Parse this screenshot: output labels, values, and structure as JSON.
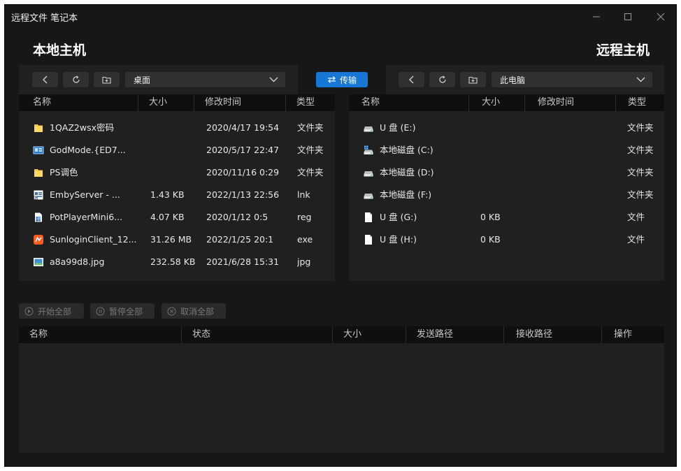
{
  "window": {
    "title": "远程文件 笔记本"
  },
  "local": {
    "heading": "本地主机",
    "path": "桌面",
    "columns": [
      "名称",
      "大小",
      "修改时间",
      "类型"
    ],
    "files": [
      {
        "name": "1QAZ2wsx密码",
        "size": "",
        "modified": "2020/4/17 19:54",
        "type": "文件夹",
        "icon": "folder-icon"
      },
      {
        "name": "GodMode.{ED7...",
        "size": "",
        "modified": "2020/5/17 22:47",
        "type": "文件夹",
        "icon": "control-panel-icon"
      },
      {
        "name": "PS调色",
        "size": "",
        "modified": "2020/11/16 0:29",
        "type": "文件夹",
        "icon": "folder-icon"
      },
      {
        "name": "EmbyServer - ...",
        "size": "1.43 KB",
        "modified": "2022/1/13 22:56",
        "type": "lnk",
        "icon": "shortcut-icon"
      },
      {
        "name": "PotPlayerMini6...",
        "size": "4.07 KB",
        "modified": "2020/1/12 0:5",
        "type": "reg",
        "icon": "registry-icon"
      },
      {
        "name": "SunloginClient_12...",
        "size": "31.26 MB",
        "modified": "2022/1/25 20:1",
        "type": "exe",
        "icon": "sunlogin-app-icon"
      },
      {
        "name": "a8a99d8.jpg",
        "size": "232.58 KB",
        "modified": "2021/6/28 15:31",
        "type": "jpg",
        "icon": "image-file-icon"
      }
    ]
  },
  "transfer": {
    "label": "传输"
  },
  "remote": {
    "heading": "远程主机",
    "path": "此电脑",
    "columns": [
      "名称",
      "大小",
      "修改时间",
      "类型"
    ],
    "files": [
      {
        "name": "U 盘 (E:)",
        "size": "",
        "modified": "",
        "type": "文件夹",
        "icon": "drive-icon"
      },
      {
        "name": "本地磁盘 (C:)",
        "size": "",
        "modified": "",
        "type": "文件夹",
        "icon": "system-drive-icon"
      },
      {
        "name": "本地磁盘 (D:)",
        "size": "",
        "modified": "",
        "type": "文件夹",
        "icon": "drive-icon"
      },
      {
        "name": "本地磁盘 (F:)",
        "size": "",
        "modified": "",
        "type": "文件夹",
        "icon": "drive-icon"
      },
      {
        "name": "U 盘 (G:)",
        "size": "0 KB",
        "modified": "",
        "type": "文件",
        "icon": "blank-file-icon"
      },
      {
        "name": "U 盘 (H:)",
        "size": "0 KB",
        "modified": "",
        "type": "文件",
        "icon": "blank-file-icon"
      }
    ]
  },
  "queue": {
    "start_all": "开始全部",
    "pause_all": "暂停全部",
    "cancel_all": "取消全部",
    "columns": [
      "名称",
      "状态",
      "大小",
      "发送路径",
      "接收路径",
      "操作"
    ]
  },
  "colors": {
    "background": "#171717",
    "panel": "#202020",
    "header": "#0f0f0f",
    "accent": "#1677d6",
    "folder": "#f5c542"
  }
}
